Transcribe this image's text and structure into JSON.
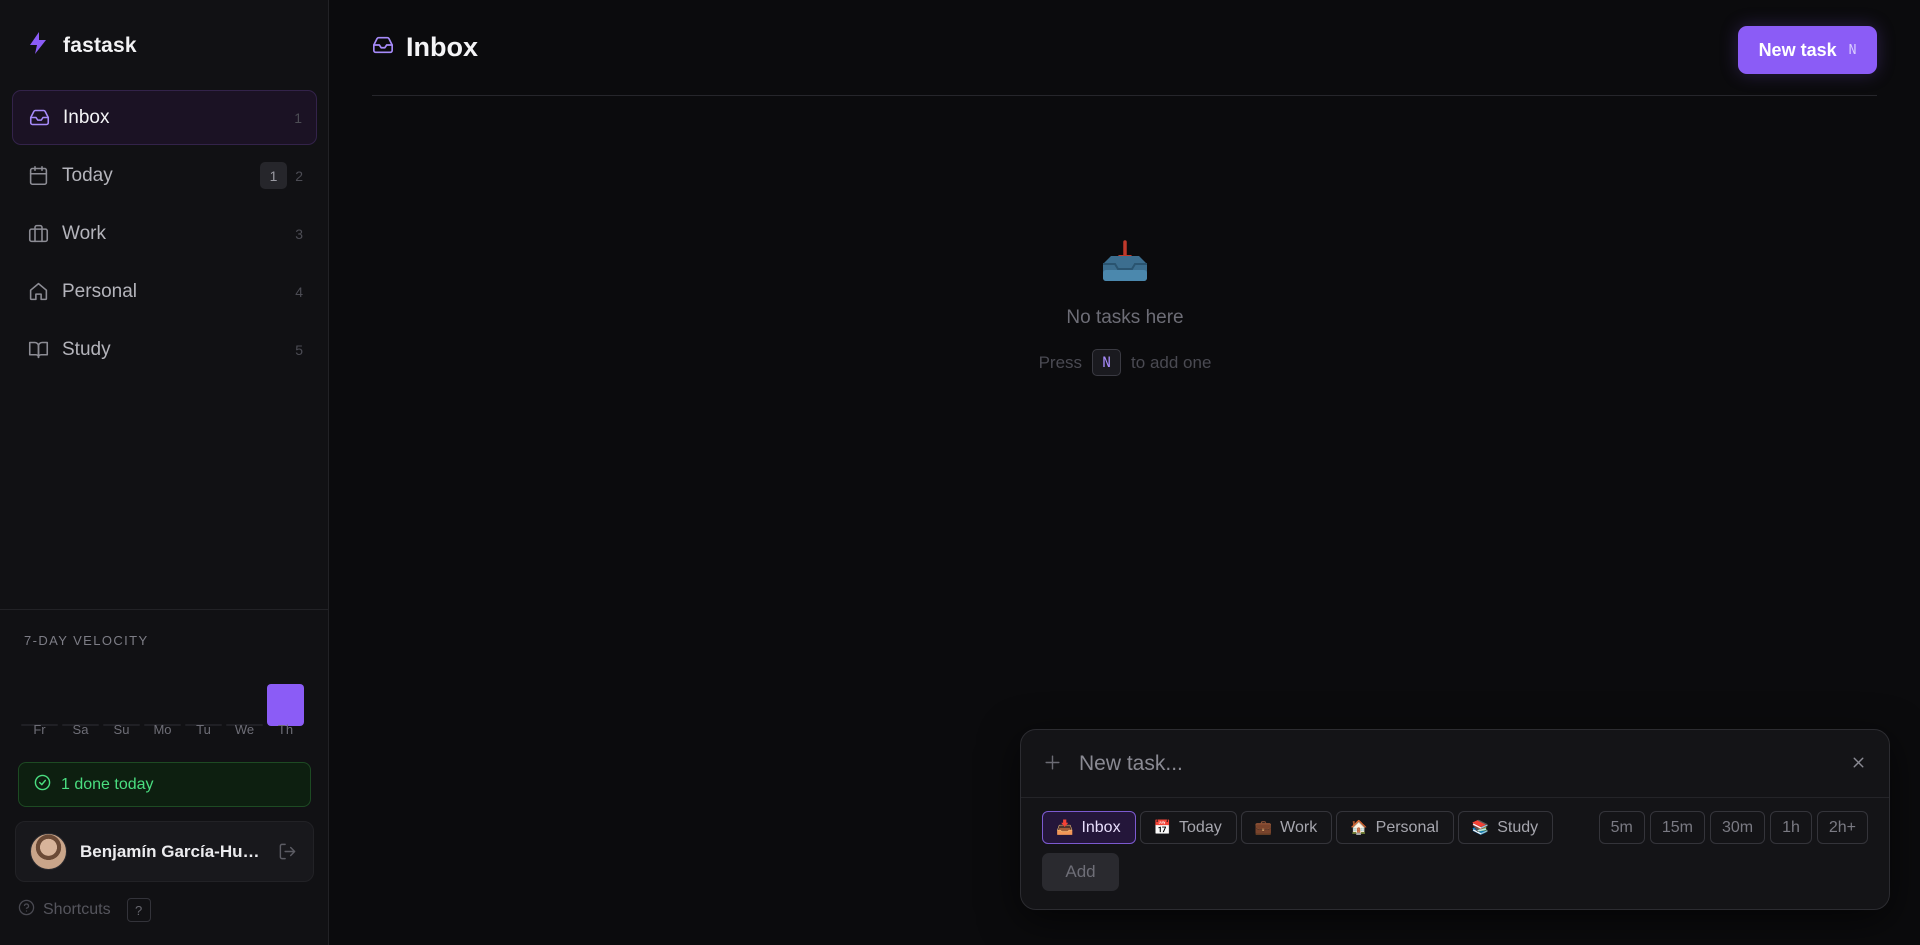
{
  "app": {
    "name": "fastask"
  },
  "sidebar": {
    "items": [
      {
        "label": "Inbox",
        "shortcut": "1",
        "icon": "inbox-icon",
        "active": true
      },
      {
        "label": "Today",
        "shortcut": "2",
        "badge": "1",
        "icon": "calendar-icon"
      },
      {
        "label": "Work",
        "shortcut": "3",
        "icon": "briefcase-icon"
      },
      {
        "label": "Personal",
        "shortcut": "4",
        "icon": "home-icon"
      },
      {
        "label": "Study",
        "shortcut": "5",
        "icon": "book-icon"
      }
    ],
    "velocity": {
      "label": "7-DAY VELOCITY",
      "days": [
        "Fr",
        "Sa",
        "Su",
        "Mo",
        "Tu",
        "We",
        "Th"
      ],
      "values": [
        0,
        0,
        0,
        0,
        0,
        0,
        1
      ]
    },
    "done_today": "1 done today",
    "user": {
      "name": "Benjamín García-Hui…"
    },
    "shortcuts_label": "Shortcuts",
    "shortcuts_key": "?"
  },
  "header": {
    "title": "Inbox",
    "new_task_label": "New task",
    "new_task_key": "N"
  },
  "empty": {
    "title": "No tasks here",
    "hint_before": "Press",
    "hint_key": "N",
    "hint_after": "to add one"
  },
  "composer": {
    "placeholder": "New task...",
    "lists": [
      {
        "emoji": "📥",
        "label": "Inbox",
        "active": true
      },
      {
        "emoji": "📅",
        "label": "Today"
      },
      {
        "emoji": "💼",
        "label": "Work"
      },
      {
        "emoji": "🏠",
        "label": "Personal"
      },
      {
        "emoji": "📚",
        "label": "Study"
      }
    ],
    "durations": [
      "5m",
      "15m",
      "30m",
      "1h",
      "2h+"
    ],
    "add_label": "Add"
  },
  "colors": {
    "accent": "#8b5cf6",
    "success": "#4ade80",
    "background": "#0b0b0d"
  }
}
